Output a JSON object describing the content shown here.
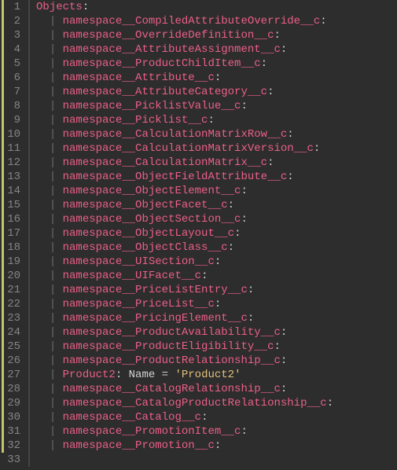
{
  "root_key": "Objects",
  "product2_line": {
    "key": "Product2",
    "prop": "Name",
    "value": "'Product2'"
  },
  "lines": [
    {
      "num": 1,
      "type": "root"
    },
    {
      "num": 2,
      "type": "entry",
      "key": "namespace__CompiledAttributeOverride__c"
    },
    {
      "num": 3,
      "type": "entry",
      "key": "namespace__OverrideDefinition__c"
    },
    {
      "num": 4,
      "type": "entry",
      "key": "namespace__AttributeAssignment__c"
    },
    {
      "num": 5,
      "type": "entry",
      "key": "namespace__ProductChildItem__c"
    },
    {
      "num": 6,
      "type": "entry",
      "key": "namespace__Attribute__c"
    },
    {
      "num": 7,
      "type": "entry",
      "key": "namespace__AttributeCategory__c"
    },
    {
      "num": 8,
      "type": "entry",
      "key": "namespace__PicklistValue__c"
    },
    {
      "num": 9,
      "type": "entry",
      "key": "namespace__Picklist__c"
    },
    {
      "num": 10,
      "type": "entry",
      "key": "namespace__CalculationMatrixRow__c"
    },
    {
      "num": 11,
      "type": "entry",
      "key": "namespace__CalculationMatrixVersion__c"
    },
    {
      "num": 12,
      "type": "entry",
      "key": "namespace__CalculationMatrix__c"
    },
    {
      "num": 13,
      "type": "entry",
      "key": "namespace__ObjectFieldAttribute__c"
    },
    {
      "num": 14,
      "type": "entry",
      "key": "namespace__ObjectElement__c"
    },
    {
      "num": 15,
      "type": "entry",
      "key": "namespace__ObjectFacet__c"
    },
    {
      "num": 16,
      "type": "entry",
      "key": "namespace__ObjectSection__c"
    },
    {
      "num": 17,
      "type": "entry",
      "key": "namespace__ObjectLayout__c"
    },
    {
      "num": 18,
      "type": "entry",
      "key": "namespace__ObjectClass__c"
    },
    {
      "num": 19,
      "type": "entry",
      "key": "namespace__UISection__c"
    },
    {
      "num": 20,
      "type": "entry",
      "key": "namespace__UIFacet__c"
    },
    {
      "num": 21,
      "type": "entry",
      "key": "namespace__PriceListEntry__c"
    },
    {
      "num": 22,
      "type": "entry",
      "key": "namespace__PriceList__c"
    },
    {
      "num": 23,
      "type": "entry",
      "key": "namespace__PricingElement__c"
    },
    {
      "num": 24,
      "type": "entry",
      "key": "namespace__ProductAvailability__c"
    },
    {
      "num": 25,
      "type": "entry",
      "key": "namespace__ProductEligibility__c"
    },
    {
      "num": 26,
      "type": "entry",
      "key": "namespace__ProductRelationship__c"
    },
    {
      "num": 27,
      "type": "product2"
    },
    {
      "num": 28,
      "type": "entry",
      "key": "namespace__CatalogRelationship__c"
    },
    {
      "num": 29,
      "type": "entry",
      "key": "namespace__CatalogProductRelationship__c"
    },
    {
      "num": 30,
      "type": "entry",
      "key": "namespace__Catalog__c"
    },
    {
      "num": 31,
      "type": "entry",
      "key": "namespace__PromotionItem__c"
    },
    {
      "num": 32,
      "type": "entry",
      "key": "namespace__Promotion__c"
    },
    {
      "num": 33,
      "type": "blank"
    }
  ]
}
